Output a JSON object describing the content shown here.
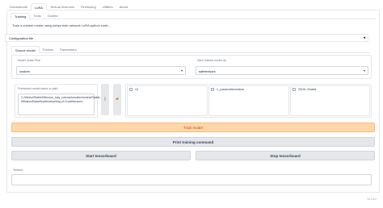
{
  "top_tabs": [
    "Dreambooth",
    "LoRA",
    "Textual Inversion",
    "Finetuning",
    "Utilities",
    "About"
  ],
  "sub_tabs": [
    "Training",
    "Tools",
    "Guides"
  ],
  "description": "Train a custom model using kohya train network LoRA python code...",
  "config": {
    "label": "Configuration file",
    "arrow": "◂"
  },
  "inner_tabs": [
    "Source model",
    "Folders",
    "Parameters"
  ],
  "model_quick_pick": {
    "label": "Model Quick Pick",
    "value": "custom"
  },
  "save_model_as": {
    "label": "Save trained model as",
    "value": "safetensors"
  },
  "pretrained": {
    "label": "Pretrained model name or path",
    "value": "C:/Webui/StableDiffusion_tuky_nolo/automatic/models/Stable-diffusion/BaseModels/anything-v4.5.safetensors"
  },
  "checkboxes": [
    "v2",
    "v_parameterization",
    "SDXL Model"
  ],
  "buttons": {
    "train": "Train model",
    "print": "Print training command",
    "start_tb": "Start tensorboard",
    "stop_tb": "Stop tensorboard"
  },
  "textbox_label": "Textbox",
  "version": "v21.8.2",
  "colors": {
    "accent_orange": "#fed7aa",
    "orange_text": "#c2410c",
    "button_gray": "#e5e7eb"
  }
}
